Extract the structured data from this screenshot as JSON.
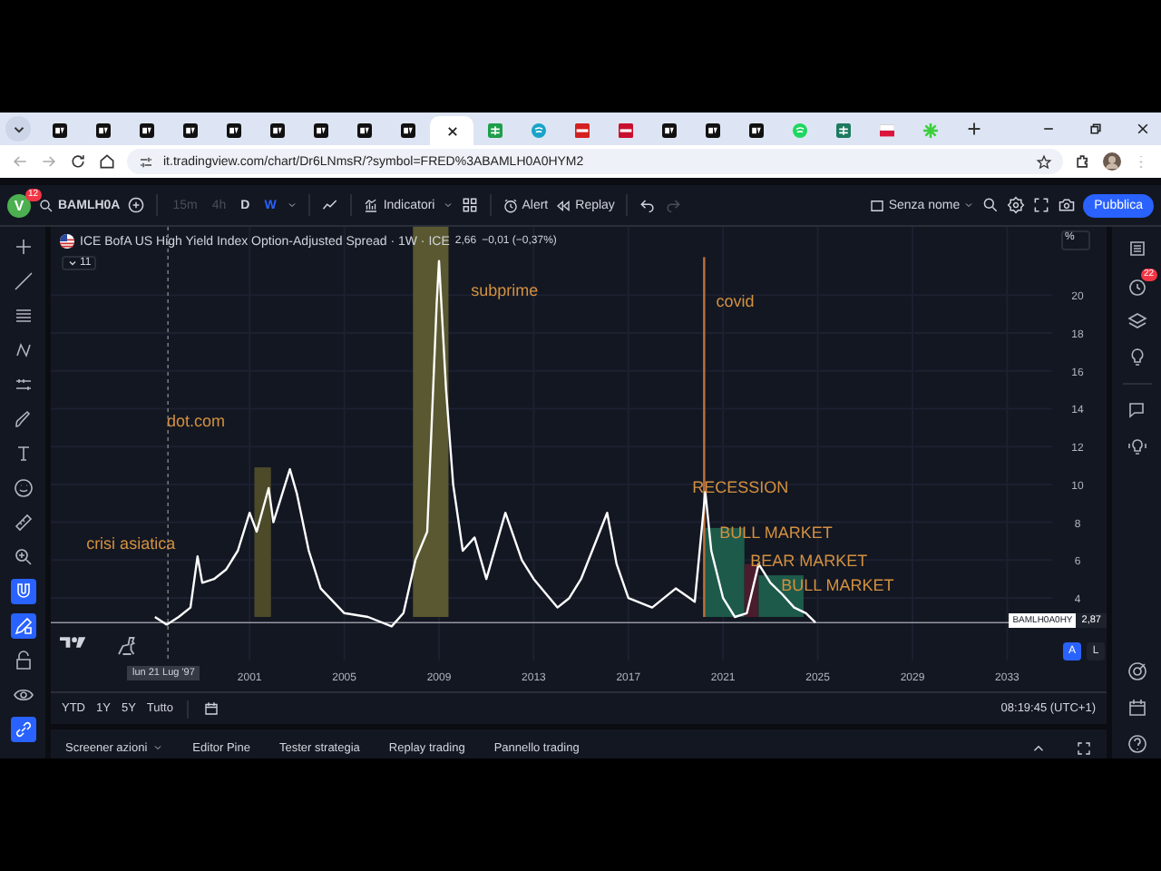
{
  "browser": {
    "tabs": [
      {
        "kind": "tv",
        "selected": false
      },
      {
        "kind": "tv",
        "selected": false
      },
      {
        "kind": "tv",
        "selected": false
      },
      {
        "kind": "tv",
        "selected": false
      },
      {
        "kind": "tv",
        "selected": false
      },
      {
        "kind": "tv",
        "selected": false
      },
      {
        "kind": "tv",
        "selected": false
      },
      {
        "kind": "tv",
        "selected": false
      },
      {
        "kind": "tv",
        "selected": false
      },
      {
        "kind": "page",
        "selected": true
      },
      {
        "kind": "sheet",
        "selected": false
      },
      {
        "kind": "globe",
        "selected": false
      },
      {
        "kind": "red",
        "selected": false
      },
      {
        "kind": "stripe",
        "selected": false
      },
      {
        "kind": "tv",
        "selected": false
      },
      {
        "kind": "tv",
        "selected": false
      },
      {
        "kind": "tv",
        "selected": false
      },
      {
        "kind": "music",
        "selected": false
      },
      {
        "kind": "grid",
        "selected": false
      },
      {
        "kind": "flag",
        "selected": false
      },
      {
        "kind": "star",
        "selected": false
      }
    ],
    "nav": [
      {
        "kind": "back",
        "disabled": true
      },
      {
        "kind": "forward",
        "disabled": true
      },
      {
        "kind": "reload",
        "disabled": false
      },
      {
        "kind": "home",
        "disabled": false
      }
    ],
    "url": "it.tradingview.com/chart/Dr6LNmsR/?symbol=FRED%3ABAMLH0A0HYM2"
  },
  "toolbar": {
    "avatar": "V",
    "avatar_badge": "12",
    "symbol": "BAMLH0A",
    "intervals": [
      {
        "label": "15m",
        "disabled": true,
        "selected": false
      },
      {
        "label": "4h",
        "disabled": true,
        "selected": false
      },
      {
        "label": "D",
        "disabled": false,
        "selected": false
      },
      {
        "label": "W",
        "disabled": false,
        "selected": true
      }
    ],
    "indicators": "Indicatori",
    "alert": "Alert",
    "replay": "Replay",
    "layout_name": "Senza nome",
    "publish": "Pubblica"
  },
  "left_tools": [
    {
      "kind": "crosshair",
      "selected": false
    },
    {
      "kind": "trendline",
      "selected": false
    },
    {
      "kind": "fib",
      "selected": false
    },
    {
      "kind": "pattern",
      "selected": false
    },
    {
      "kind": "ranges",
      "selected": false
    },
    {
      "kind": "brush",
      "selected": false
    },
    {
      "kind": "text",
      "selected": false
    },
    {
      "kind": "emoji",
      "selected": false
    },
    {
      "kind": "ruler",
      "selected": false
    },
    {
      "kind": "zoom",
      "selected": false
    },
    {
      "kind": "magnet",
      "selected": true
    },
    {
      "kind": "pencil_lock",
      "selected": true
    },
    {
      "kind": "lock",
      "selected": false
    },
    {
      "kind": "eye",
      "selected": false
    },
    {
      "kind": "link",
      "selected": true
    }
  ],
  "chart": {
    "title": "ICE BofA US High Yield Index Option-Adjusted Spread · 1W · ICE",
    "value": "2,66",
    "change": "−0,01 (−0,37%)",
    "indicators_count": "11",
    "scale_unit": "%",
    "crosshair_date": "lun 21 Lug '97",
    "last_price": "2,87",
    "scale_modes": [
      {
        "label": "A",
        "selected": true
      },
      {
        "label": "L",
        "selected": false
      }
    ],
    "chart_data": {
      "type": "line",
      "grid": true,
      "xlim": [
        1992.6,
        2034.9
      ],
      "ylim": [
        0.7,
        23.6
      ],
      "xticks": [
        2001,
        2005,
        2009,
        2013,
        2017,
        2021,
        2025,
        2029,
        2033
      ],
      "yticks": [
        4,
        6,
        8,
        10,
        12,
        14,
        16,
        18,
        20
      ],
      "x": [
        1997.0,
        1997.5,
        1998.0,
        1998.5,
        1998.8,
        1999.0,
        1999.5,
        2000.0,
        2000.5,
        2001.0,
        2001.3,
        2001.8,
        2002.0,
        2002.7,
        2003.0,
        2003.5,
        2004.0,
        2005.0,
        2006.0,
        2007.0,
        2007.5,
        2008.0,
        2008.5,
        2008.9,
        2009.0,
        2009.3,
        2009.6,
        2010.0,
        2010.5,
        2011.0,
        2011.8,
        2012.5,
        2013.0,
        2014.0,
        2014.5,
        2015.0,
        2016.1,
        2016.5,
        2017.0,
        2018.0,
        2019.0,
        2019.8,
        2020.25,
        2020.5,
        2021.0,
        2021.5,
        2022.0,
        2022.5,
        2023.0,
        2023.5,
        2024.0,
        2024.5,
        2024.9
      ],
      "series": [
        {
          "name": "BAMLH0A0HY",
          "color": "#ffffff",
          "values": [
            3.0,
            2.6,
            3.0,
            3.5,
            6.2,
            4.8,
            5.0,
            5.5,
            6.5,
            8.5,
            7.5,
            9.8,
            8.0,
            10.8,
            9.5,
            6.5,
            4.5,
            3.2,
            3.0,
            2.5,
            3.2,
            6.0,
            7.5,
            19.5,
            21.8,
            15.0,
            10.0,
            6.5,
            7.2,
            5.0,
            8.5,
            6.0,
            5.0,
            3.5,
            4.0,
            5.0,
            8.5,
            5.8,
            4.0,
            3.5,
            4.5,
            3.8,
            9.6,
            6.5,
            4.0,
            3.0,
            3.2,
            5.8,
            4.8,
            4.2,
            3.5,
            3.2,
            2.7
          ]
        }
      ],
      "bands": [
        {
          "axis": "x",
          "from": 2001.2,
          "to": 2001.9,
          "color": "#4d4a2a"
        },
        {
          "axis": "x",
          "from": 2007.9,
          "to": 2009.4,
          "color": "#5a5830"
        },
        {
          "axis": "x",
          "from": 2020.2,
          "to": 2021.9,
          "color": "#1d5a4a"
        },
        {
          "axis": "x",
          "from": 2021.9,
          "to": 2022.5,
          "color": "#4a1c2c"
        },
        {
          "axis": "x",
          "from": 2022.5,
          "to": 2024.4,
          "color": "#1d5a4a"
        }
      ],
      "ref_lines": [
        {
          "axis": "x",
          "value": 2020.2,
          "color": "#c0703a"
        },
        {
          "axis": "x",
          "value": 1997.55,
          "color": "#777777"
        },
        {
          "axis": "y",
          "value": 2.7,
          "color": "#9598a1"
        }
      ],
      "annotations": [
        "crisi asiatica",
        "dot.com",
        "subprime",
        "covid",
        "RECESSION",
        "BULL MARKET",
        "BEAR MARKET",
        "BULL MARKET"
      ]
    }
  },
  "range_bar": {
    "ranges": [
      "YTD",
      "1Y",
      "5Y",
      "Tutto"
    ],
    "clock": "08:19:45 (UTC+1)"
  },
  "bottom_tabs": [
    "Screener azioni",
    "Editor Pine",
    "Tester strategia",
    "Replay trading",
    "Pannello trading"
  ],
  "right_sidebar": {
    "alert_badge": "22"
  }
}
